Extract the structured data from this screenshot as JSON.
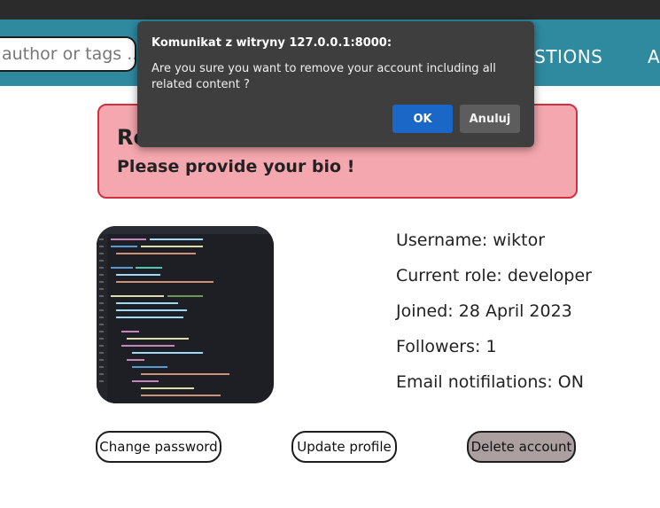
{
  "search": {
    "placeholder": "author or tags ..."
  },
  "nav": {
    "questions": "ESTIONS",
    "more": "A"
  },
  "alert": {
    "title": "Re",
    "message": "Please provide your bio !"
  },
  "profile": {
    "username": "Username: wiktor",
    "role": "Current role: developer",
    "joined": "Joined: 28 April 2023",
    "followers": "Followers: 1",
    "email_notifications": "Email notifilations: ON"
  },
  "actions": {
    "change_password": "Change password",
    "update_profile": "Update profile",
    "delete_account": "Delete account"
  },
  "dialog": {
    "title": "Komunikat z witryny 127.0.0.1:8000:",
    "message": "Are you sure you want to remove your account including all related content ?",
    "ok": "OK",
    "cancel": "Anuluj"
  },
  "colors": {
    "navbar": "#2f8aa0",
    "alert_background": "#f4a7ae",
    "alert_border": "#d1303f",
    "delete_button": "#ab9f9f",
    "dialog_background": "#3e3e3e",
    "dialog_ok": "#1a67c8"
  }
}
